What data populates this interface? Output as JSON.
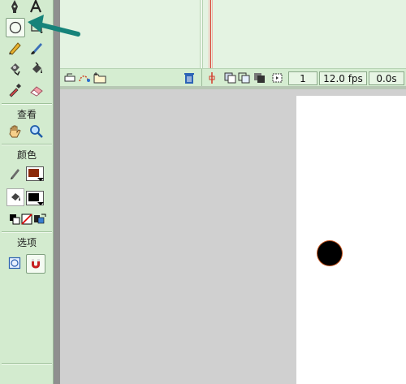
{
  "toolbox": {
    "view_label": "查看",
    "color_label": "颜色",
    "options_label": "选项",
    "tools": [
      {
        "name": "pen-icon"
      },
      {
        "name": "text-icon"
      },
      {
        "name": "oval-icon",
        "selected": true
      },
      {
        "name": "rectangle-icon"
      },
      {
        "name": "pencil-icon"
      },
      {
        "name": "brush-icon"
      },
      {
        "name": "ink-bottle-icon"
      },
      {
        "name": "paint-bucket-icon"
      },
      {
        "name": "eyedropper-icon"
      },
      {
        "name": "eraser-icon"
      }
    ],
    "stroke_color": "#8b2a0a",
    "fill_color": "#000000"
  },
  "timeline": {
    "frame_number": "1",
    "frame_rate": "12.0 fps",
    "elapsed_time": "0.0s"
  },
  "stage": {
    "circle_fill": "#000000",
    "circle_stroke": "#c0501a"
  },
  "annotation": {
    "arrow_color": "#16837a"
  }
}
